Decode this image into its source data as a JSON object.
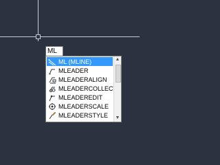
{
  "command_input": {
    "value": "ML"
  },
  "autocomplete": {
    "items": [
      {
        "label": "ML (MLINE)",
        "icon": "mline-icon",
        "selected": true
      },
      {
        "label": "MLEADER",
        "icon": "mleader-icon",
        "selected": false
      },
      {
        "label": "MLEADERALIGN",
        "icon": "mleader-align-icon",
        "selected": false
      },
      {
        "label": "MLEADERCOLLECT",
        "icon": "mleader-collect-icon",
        "selected": false
      },
      {
        "label": "MLEADEREDIT",
        "icon": "mleader-edit-icon",
        "selected": false
      },
      {
        "label": "MLEADERSCALE",
        "icon": "mleader-scale-icon",
        "selected": false
      },
      {
        "label": "MLEADERSTYLE",
        "icon": "mleader-style-icon",
        "selected": false
      }
    ]
  },
  "colors": {
    "canvas_background": "#2b3240",
    "selection": "#3399ff",
    "crosshair": "#c9cdd3"
  }
}
